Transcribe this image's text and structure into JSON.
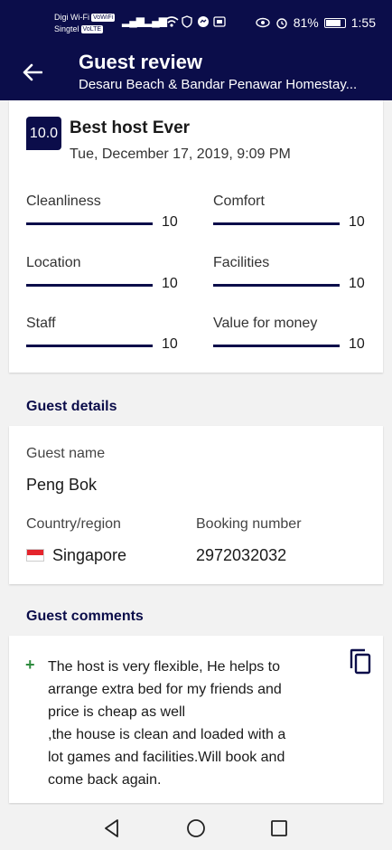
{
  "status_bar": {
    "carrier1": "Digi Wi-Fi",
    "carrier1_tag": "VoWiFi",
    "carrier2": "Singtel",
    "carrier2_tag": "VoLTE",
    "battery": "81%",
    "time": "1:55"
  },
  "header": {
    "title": "Guest review",
    "subtitle": "Desaru Beach & Bandar Penawar Homestay..."
  },
  "review": {
    "score": "10.0",
    "title": "Best host Ever",
    "date": "Tue, December 17, 2019, 9:09 PM",
    "ratings": [
      {
        "label": "Cleanliness",
        "value": "10",
        "fraction": 1.0
      },
      {
        "label": "Comfort",
        "value": "10",
        "fraction": 1.0
      },
      {
        "label": "Location",
        "value": "10",
        "fraction": 1.0
      },
      {
        "label": "Facilities",
        "value": "10",
        "fraction": 1.0
      },
      {
        "label": "Staff",
        "value": "10",
        "fraction": 1.0
      },
      {
        "label": "Value for money",
        "value": "10",
        "fraction": 1.0
      }
    ]
  },
  "guest_details": {
    "heading": "Guest details",
    "name_label": "Guest name",
    "name": "Peng Bok",
    "country_label": "Country/region",
    "country": "Singapore",
    "booking_label": "Booking number",
    "booking_number": "2972032032"
  },
  "comments": {
    "heading": "Guest comments",
    "text": "The host is very flexible, He helps to\narrange extra bed for my friends and\nprice is cheap as well\n,the house is clean and loaded with a\nlot games and facilities.Will book and\ncome back again.",
    "icon": "plus-icon"
  },
  "colors": {
    "brand": "#0b0d4a",
    "positive": "#2e8b3e"
  }
}
